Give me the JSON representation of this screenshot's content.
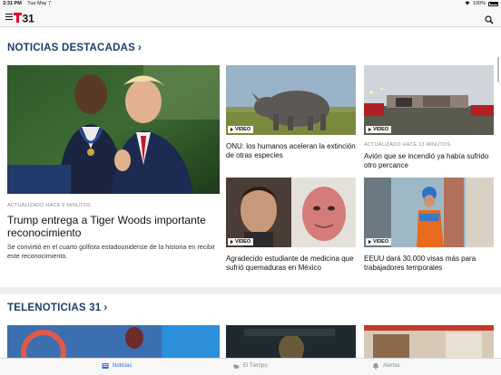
{
  "status_bar": {
    "time": "3:31 PM",
    "date": "Tue May 7",
    "battery": "100%"
  },
  "header": {
    "logo": "T31"
  },
  "sections": {
    "featured": {
      "title": "NOTICIAS DESTACADAS"
    },
    "telenoticias": {
      "title": "TELENOTICIAS 31"
    }
  },
  "lead_story": {
    "kicker": "ACTUALIZADO HACE 8 MINUTOS",
    "headline": "Trump entrega a Tiger Woods importante reconocimiento",
    "summary": "Se convirtió en el cuarto golfista estadounidense de la historia en recibir este reconocimiento."
  },
  "cards": [
    {
      "badge": "VIDEO",
      "kicker": "",
      "headline": "ONU: los humanos aceleran la extinción de otras especies"
    },
    {
      "badge": "VIDEO",
      "kicker": "ACTUALIZADO HACE 13 MINUTOS",
      "headline": "Avión que se incendió ya había sufrido otro percance"
    },
    {
      "badge": "VIDEO",
      "kicker": "",
      "headline": "Agradecido estudiante de medicina que sufrió quemaduras en México"
    },
    {
      "badge": "VIDEO",
      "kicker": "",
      "headline": "EEUU dará 30,000 visas más para trabajadores temporales"
    }
  ],
  "tabs": [
    {
      "label": "Noticias",
      "icon": "news-icon",
      "active": true
    },
    {
      "label": "El Tiempo",
      "icon": "weather-icon",
      "active": false
    },
    {
      "label": "Alertas",
      "icon": "bell-icon",
      "active": false
    }
  ],
  "colors": {
    "section_title": "#1d3e6e",
    "tab_active": "#2b6bd6",
    "logo_red": "#e4002b"
  }
}
